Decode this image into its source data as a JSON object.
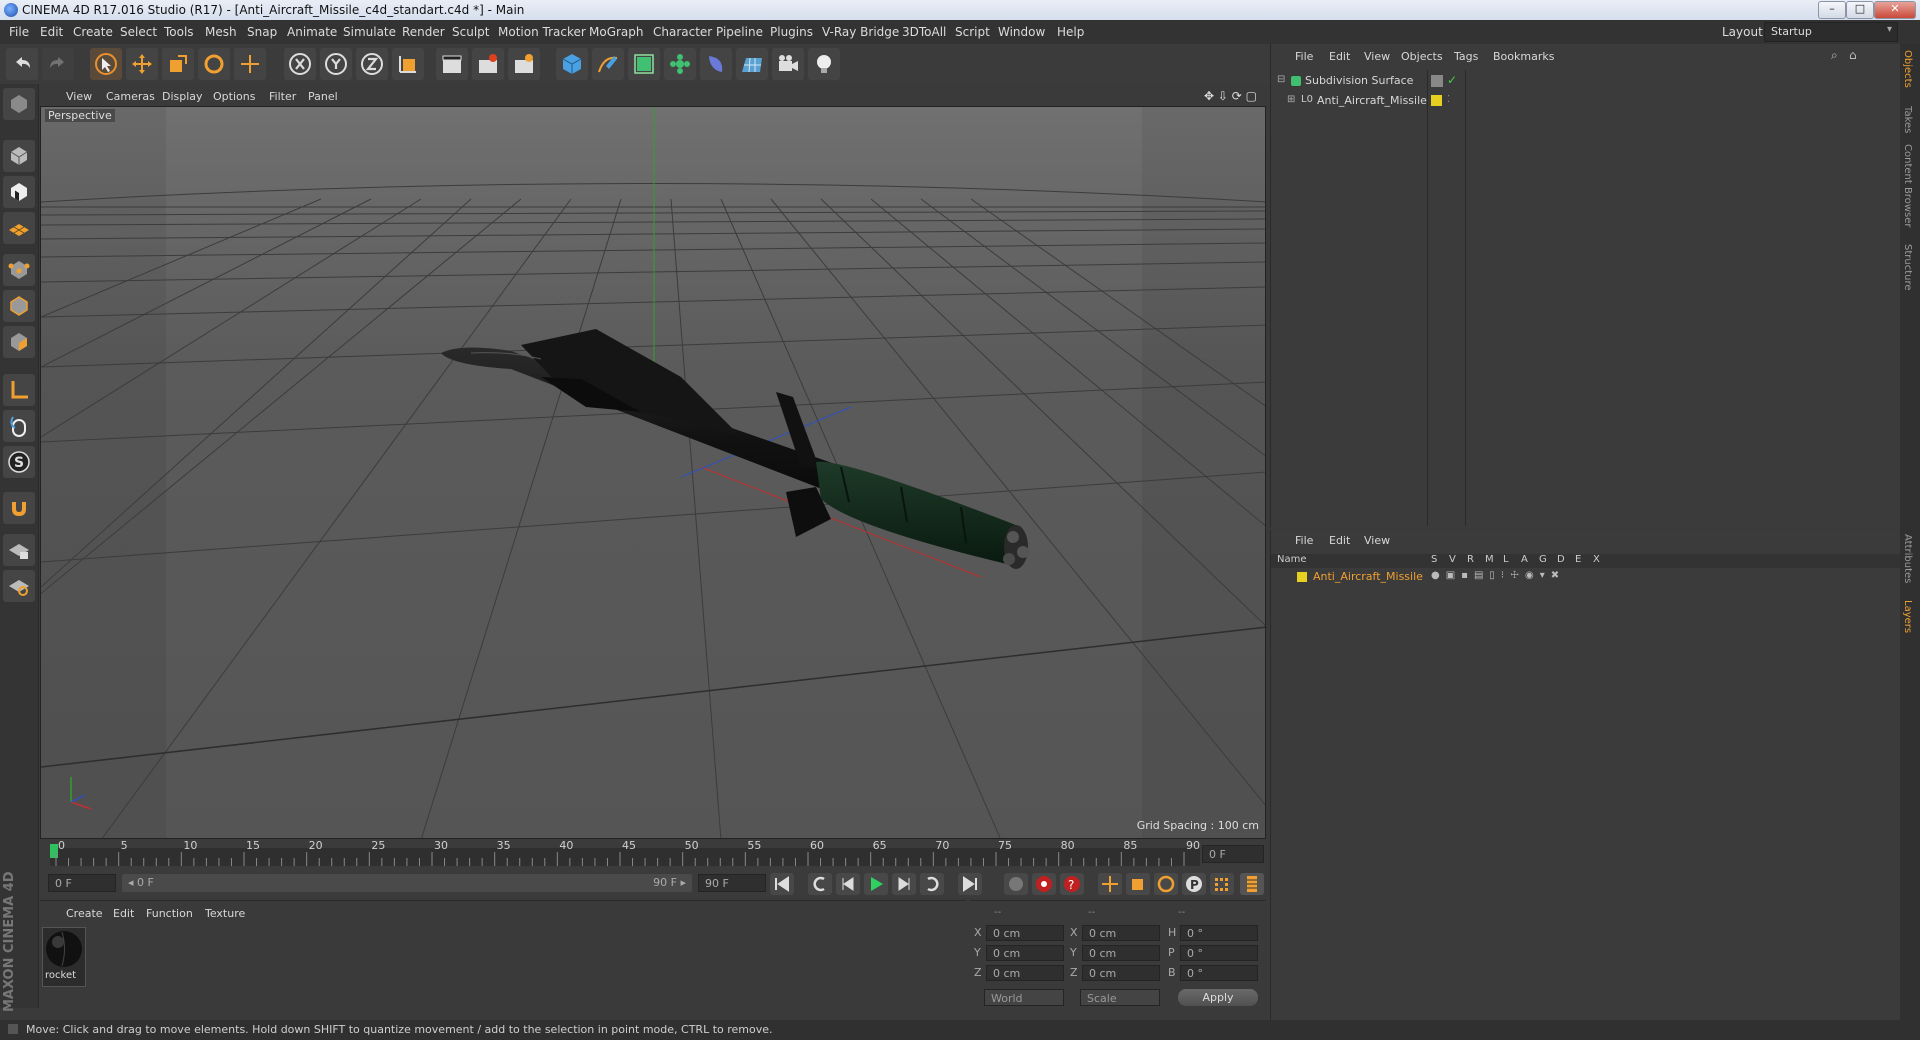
{
  "window": {
    "title": "CINEMA 4D R17.016 Studio (R17) - [Anti_Aircraft_Missile_c4d_standart.c4d *] - Main",
    "btn_min": "–",
    "btn_max": "□",
    "btn_close": "✕"
  },
  "menubar": {
    "items": [
      "File",
      "Edit",
      "Create",
      "Select",
      "Tools",
      "Mesh",
      "Snap",
      "Animate",
      "Simulate",
      "Render",
      "Sculpt",
      "Motion Tracker",
      "MoGraph",
      "Character",
      "Pipeline",
      "Plugins",
      "V-Ray Bridge",
      "3DToAll",
      "Script",
      "Window",
      "Help"
    ],
    "layout_label": "Layout:",
    "layout_value": "Startup"
  },
  "viewport": {
    "menu": [
      "View",
      "Cameras",
      "Display",
      "Options",
      "Filter",
      "Panel"
    ],
    "label": "Perspective",
    "grid_spacing": "Grid Spacing : 100 cm"
  },
  "timeline": {
    "ticks": [
      "0",
      "5",
      "10",
      "15",
      "20",
      "25",
      "30",
      "35",
      "40",
      "45",
      "50",
      "55",
      "60",
      "65",
      "70",
      "75",
      "80",
      "85",
      "90"
    ],
    "current_frame": "0 F",
    "start_field": "0 F",
    "range_start": "◂ 0 F",
    "range_end": "90 F ▸",
    "end_field": "90 F"
  },
  "material_manager": {
    "menu": [
      "Create",
      "Edit",
      "Function",
      "Texture"
    ],
    "material_name": "rocket"
  },
  "coordinates": {
    "header": [
      "--",
      "--",
      "--"
    ],
    "rows": [
      {
        "a": "X",
        "av": "0 cm",
        "b": "X",
        "bv": "0 cm",
        "c": "H",
        "cv": "0 °"
      },
      {
        "a": "Y",
        "av": "0 cm",
        "b": "Y",
        "bv": "0 cm",
        "c": "P",
        "cv": "0 °"
      },
      {
        "a": "Z",
        "av": "0 cm",
        "b": "Z",
        "bv": "0 cm",
        "c": "B",
        "cv": "0 °"
      }
    ],
    "world": "World",
    "scale": "Scale",
    "apply": "Apply"
  },
  "object_manager": {
    "menu": [
      "File",
      "Edit",
      "View",
      "Objects",
      "Tags",
      "Bookmarks"
    ],
    "objects": [
      "Subdivision Surface",
      "Anti_Aircraft_Missile"
    ]
  },
  "layer_manager": {
    "menu": [
      "File",
      "Edit",
      "View"
    ],
    "col_name": "Name",
    "cols": [
      "S",
      "V",
      "R",
      "M",
      "L",
      "A",
      "G",
      "D",
      "E",
      "X"
    ],
    "layer": "Anti_Aircraft_Missile"
  },
  "right_tabs": [
    "Objects",
    "Takes",
    "Content Browser",
    "Structure",
    "Attributes",
    "Layers"
  ],
  "brand": "MAXON CINEMA 4D",
  "status": "Move: Click and drag to move elements. Hold down SHIFT to quantize movement / add to the selection in point mode, CTRL to remove.",
  "colors": {
    "accent_orange": "#f0a030",
    "layer_yellow": "#e8d020",
    "axis_x": "#c03030",
    "axis_y": "#30a030",
    "axis_z": "#3050c0"
  }
}
